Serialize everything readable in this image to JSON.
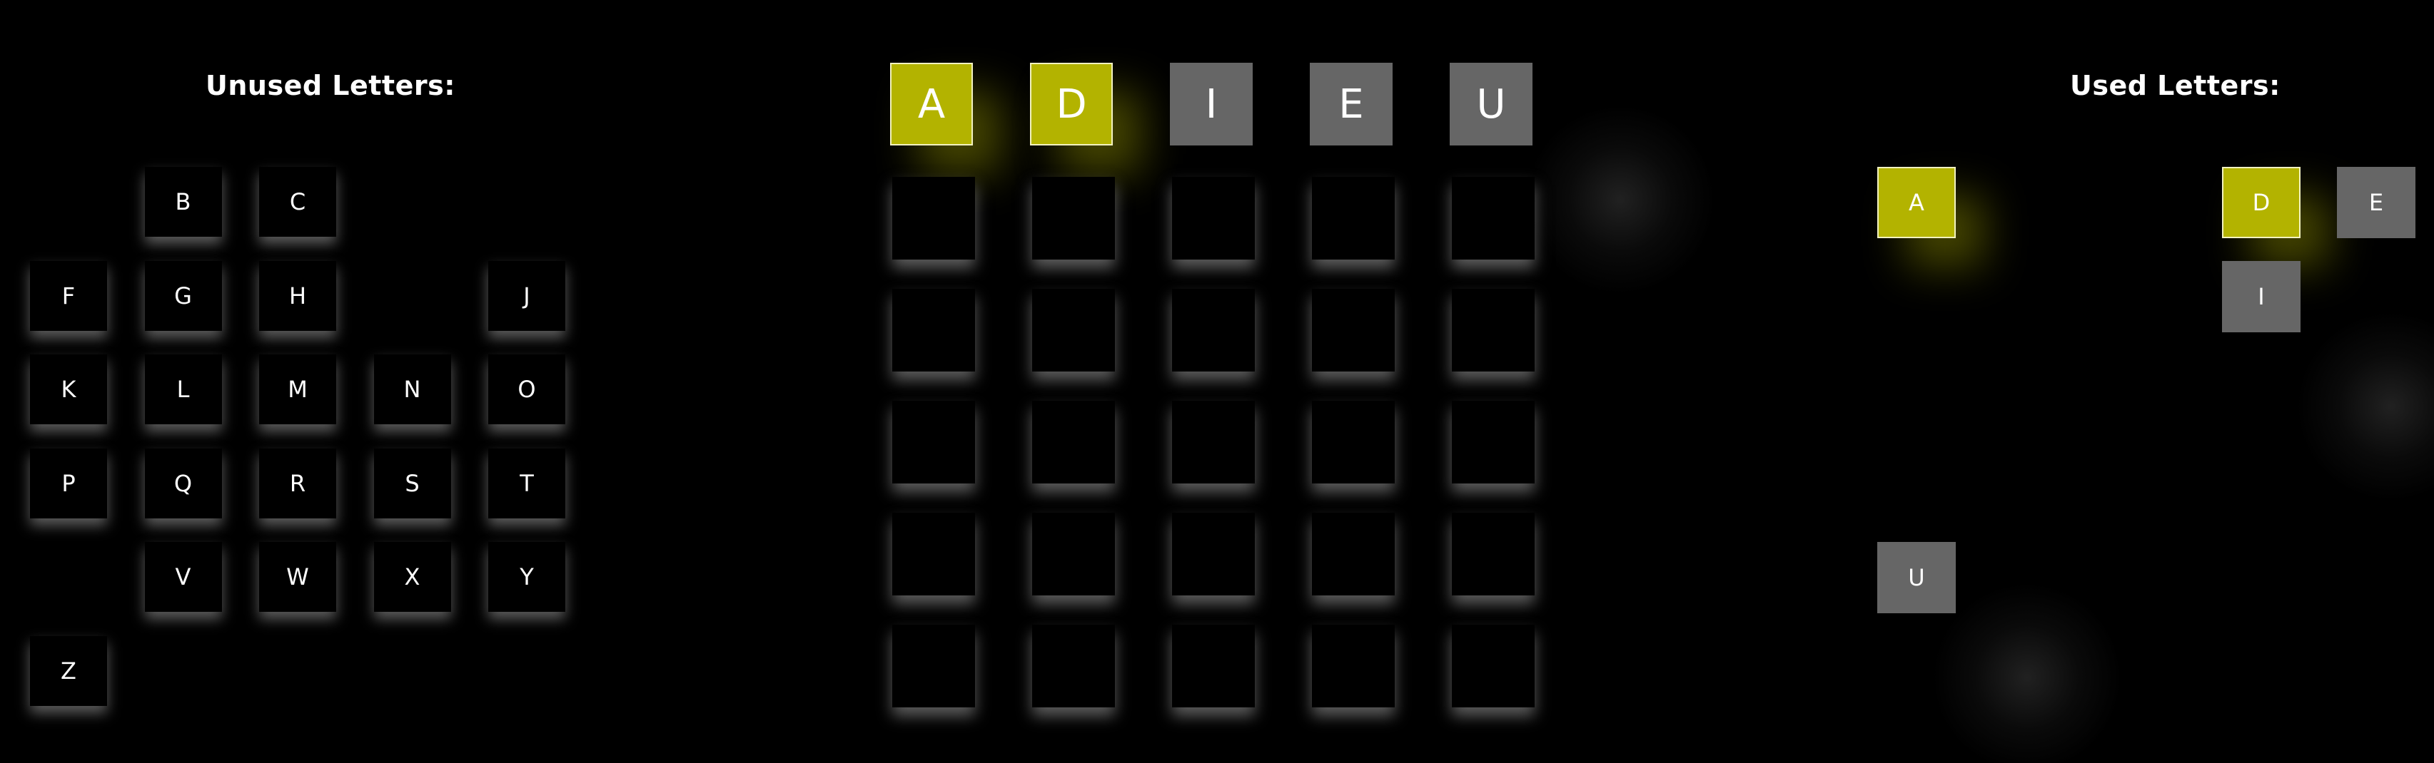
{
  "unused_panel": {
    "title": "Unused Letters:",
    "letters": [
      "B",
      "C",
      "F",
      "G",
      "H",
      "J",
      "K",
      "L",
      "M",
      "N",
      "O",
      "P",
      "Q",
      "R",
      "S",
      "T",
      "V",
      "W",
      "X",
      "Y",
      "Z"
    ]
  },
  "board": {
    "rows": [
      [
        {
          "letter": "A",
          "state": "present"
        },
        {
          "letter": "D",
          "state": "present"
        },
        {
          "letter": "I",
          "state": "absent"
        },
        {
          "letter": "E",
          "state": "absent"
        },
        {
          "letter": "U",
          "state": "absent"
        }
      ],
      [
        {
          "letter": "",
          "state": "empty"
        },
        {
          "letter": "",
          "state": "empty"
        },
        {
          "letter": "",
          "state": "empty"
        },
        {
          "letter": "",
          "state": "empty"
        },
        {
          "letter": "",
          "state": "empty"
        }
      ],
      [
        {
          "letter": "",
          "state": "empty"
        },
        {
          "letter": "",
          "state": "empty"
        },
        {
          "letter": "",
          "state": "empty"
        },
        {
          "letter": "",
          "state": "empty"
        },
        {
          "letter": "",
          "state": "empty"
        }
      ],
      [
        {
          "letter": "",
          "state": "empty"
        },
        {
          "letter": "",
          "state": "empty"
        },
        {
          "letter": "",
          "state": "empty"
        },
        {
          "letter": "",
          "state": "empty"
        },
        {
          "letter": "",
          "state": "empty"
        }
      ],
      [
        {
          "letter": "",
          "state": "empty"
        },
        {
          "letter": "",
          "state": "empty"
        },
        {
          "letter": "",
          "state": "empty"
        },
        {
          "letter": "",
          "state": "empty"
        },
        {
          "letter": "",
          "state": "empty"
        }
      ],
      [
        {
          "letter": "",
          "state": "empty"
        },
        {
          "letter": "",
          "state": "empty"
        },
        {
          "letter": "",
          "state": "empty"
        },
        {
          "letter": "",
          "state": "empty"
        },
        {
          "letter": "",
          "state": "empty"
        }
      ]
    ]
  },
  "used_panel": {
    "title": "Used Letters:",
    "letters": [
      {
        "letter": "A",
        "state": "present"
      },
      {
        "letter": "D",
        "state": "present"
      },
      {
        "letter": "E",
        "state": "absent"
      },
      {
        "letter": "I",
        "state": "absent"
      },
      {
        "letter": "U",
        "state": "absent"
      }
    ]
  },
  "colors": {
    "background": "#000000",
    "present": "#b3b300",
    "absent": "#666666",
    "text": "#ffffff"
  }
}
